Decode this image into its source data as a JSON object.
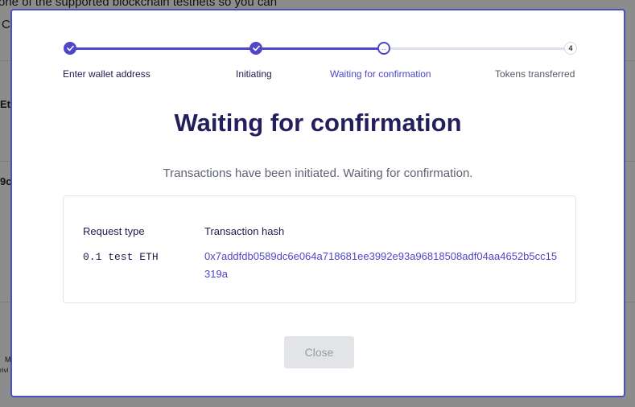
{
  "background": {
    "line1": "one of the supported blockchain testnets so you can",
    "line2": "C",
    "side_a": "Et",
    "side_b": "9c",
    "side_c": "M",
    "side_d": "rivi"
  },
  "stepper": {
    "steps": [
      {
        "label": "Enter wallet address",
        "state": "done"
      },
      {
        "label": "Initiating",
        "state": "done"
      },
      {
        "label": "Waiting for confirmation",
        "state": "current"
      },
      {
        "label": "Tokens transferred",
        "state": "pending",
        "number": "4"
      }
    ]
  },
  "modal": {
    "title": "Waiting for confirmation",
    "subtitle": "Transactions have been initiated. Waiting for confirmation.",
    "table": {
      "headers": [
        "Request type",
        "Transaction hash"
      ],
      "request_type": "0.1 test ETH",
      "transaction_hash": "0x7addfdb0589dc6e064a718681ee3992e93a96818508adf04aa4652b5cc15319a"
    },
    "close_label": "Close"
  },
  "colors": {
    "accent": "#4f46c8",
    "title": "#241f5c",
    "border": "#4a4fc4"
  }
}
